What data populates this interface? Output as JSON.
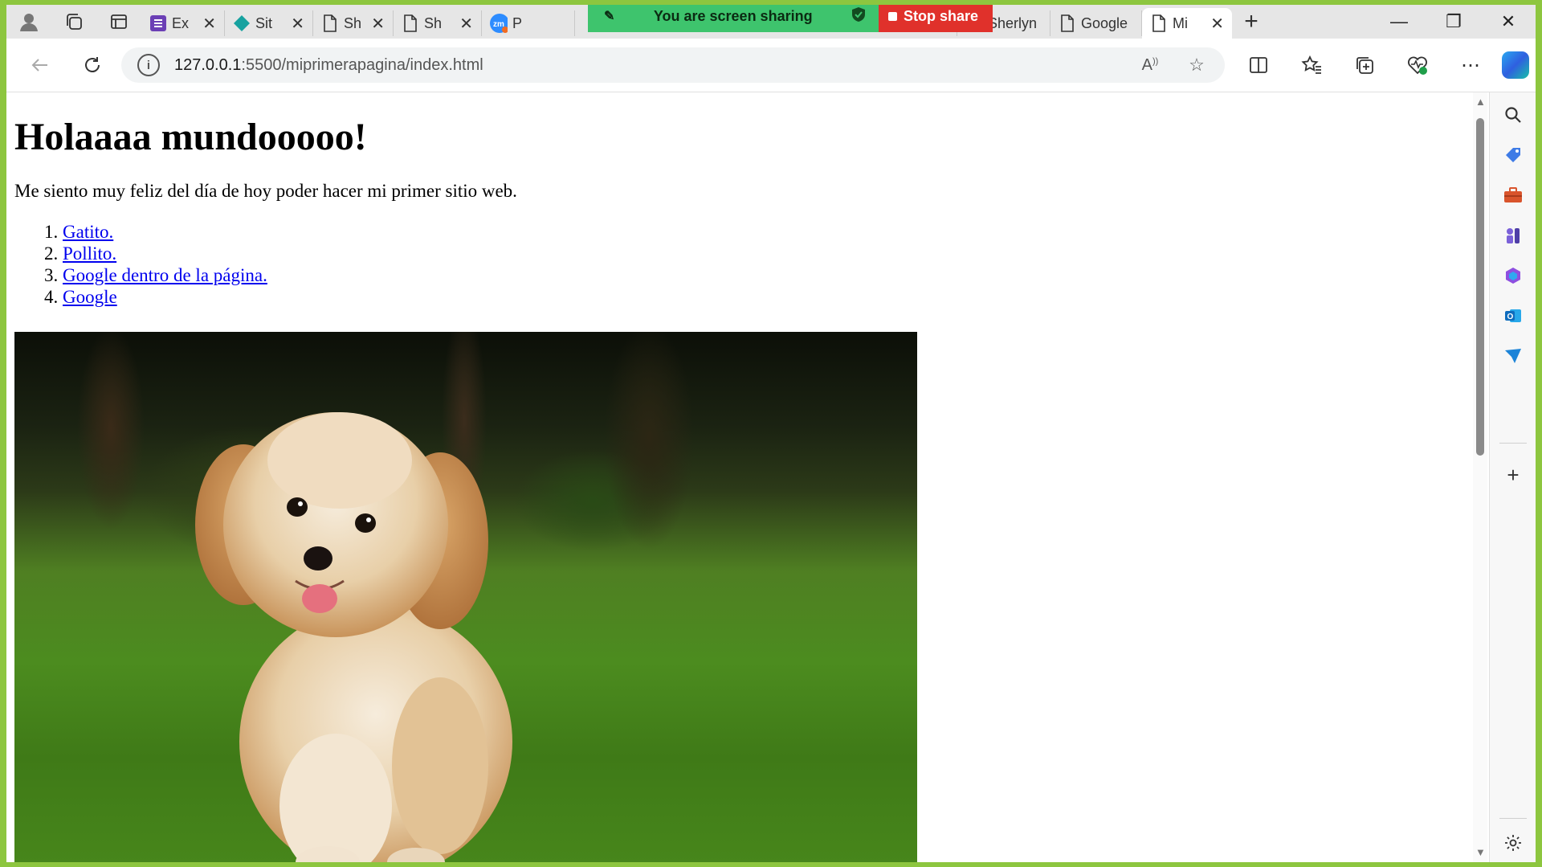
{
  "browser": {
    "tabs": [
      {
        "title": "Ex",
        "favicon": "forms-icon",
        "color": "#6b3fb5",
        "closable": true
      },
      {
        "title": "Sit",
        "favicon": "diamond-icon",
        "color": "#17a2a0",
        "closable": true
      },
      {
        "title": "Sh",
        "favicon": "page-icon",
        "closable": true
      },
      {
        "title": "Sh",
        "favicon": "page-icon",
        "closable": true
      },
      {
        "title": "P",
        "favicon": "zoom-icon",
        "color": "#2d8cff",
        "closable": false
      },
      {
        "title": "Sherlyn",
        "favicon": "page-icon",
        "closable": false
      },
      {
        "title": "Google",
        "favicon": "page-icon",
        "closable": false
      },
      {
        "title": "Mi",
        "favicon": "page-icon",
        "closable": true,
        "active": true
      }
    ],
    "new_tab_label": "+",
    "window_controls": {
      "minimize": "—",
      "restore": "❐",
      "close": "✕"
    }
  },
  "screen_share": {
    "message": "You are screen sharing",
    "stop_label": "Stop share",
    "banner_color": "#3ec46d",
    "stop_color": "#e0312b"
  },
  "address_bar": {
    "host": "127.0.0.1",
    "path": ":5500/miprimerapagina/index.html"
  },
  "page": {
    "heading": "Holaaaa mundooooo!",
    "paragraph": "Me siento muy feliz del día de hoy poder hacer mi primer sitio web.",
    "links": [
      "Gatito.",
      "Pollito.",
      "Google dentro de la página.",
      "Google"
    ],
    "link_color": "#0000ee"
  },
  "frame_color": "#8dc63f"
}
